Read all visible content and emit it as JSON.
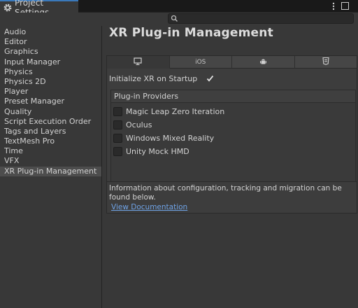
{
  "window": {
    "tab_title": "Project Settings",
    "tab_icon": "gear-icon"
  },
  "search": {
    "placeholder": ""
  },
  "sidebar": {
    "items": [
      {
        "label": "Audio"
      },
      {
        "label": "Editor"
      },
      {
        "label": "Graphics"
      },
      {
        "label": "Input Manager"
      },
      {
        "label": "Physics"
      },
      {
        "label": "Physics 2D"
      },
      {
        "label": "Player"
      },
      {
        "label": "Preset Manager"
      },
      {
        "label": "Quality"
      },
      {
        "label": "Script Execution Order"
      },
      {
        "label": "Tags and Layers"
      },
      {
        "label": "TextMesh Pro"
      },
      {
        "label": "Time"
      },
      {
        "label": "VFX"
      },
      {
        "label": "XR Plug-in Management",
        "selected": true
      }
    ]
  },
  "main": {
    "title": "XR Plug-in Management",
    "platform_tabs": [
      {
        "icon": "desktop-icon",
        "label": "",
        "active": true
      },
      {
        "icon": "ios",
        "label": "iOS",
        "active": false
      },
      {
        "icon": "android-icon",
        "label": "",
        "active": false
      },
      {
        "icon": "html5-icon",
        "label": "",
        "active": false
      }
    ],
    "init_xr": {
      "label": "Initialize XR on Startup",
      "checked": true
    },
    "providers": {
      "header": "Plug-in Providers",
      "items": [
        {
          "label": "Magic Leap Zero Iteration",
          "checked": false
        },
        {
          "label": "Oculus",
          "checked": false
        },
        {
          "label": "Windows Mixed Reality",
          "checked": false
        },
        {
          "label": "Unity Mock HMD",
          "checked": false
        }
      ]
    },
    "info": {
      "text": "Information about configuration, tracking and migration can be found below.",
      "link": "View Documentation"
    }
  },
  "colors": {
    "background": "#383838",
    "titlebar": "#191919",
    "accent": "#3a79bb",
    "link": "#6fa3e6",
    "selected": "#4d4d4d"
  }
}
